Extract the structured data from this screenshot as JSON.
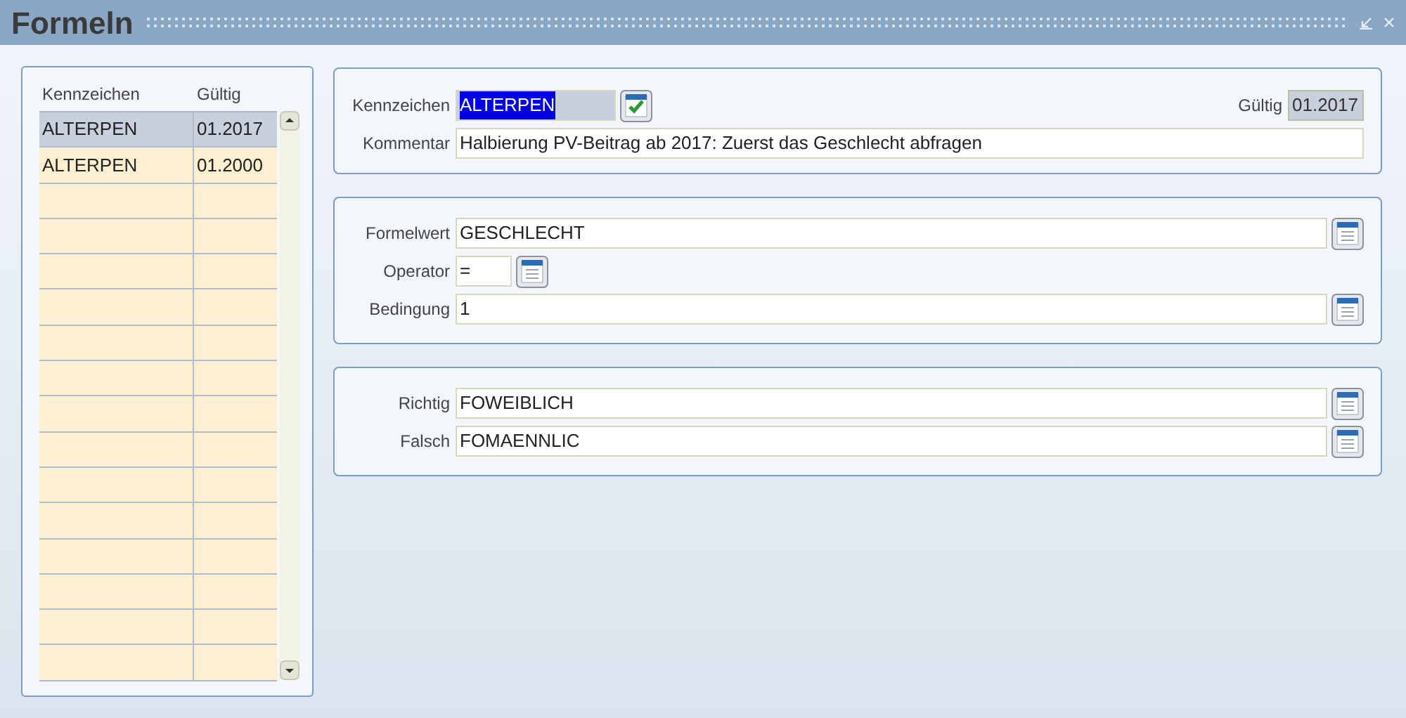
{
  "window": {
    "title": "Formeln"
  },
  "list": {
    "columns": [
      "Kennzeichen",
      "Gültig"
    ],
    "rows": [
      {
        "cells": [
          "ALTERPEN",
          "01.2017"
        ],
        "selected": true
      },
      {
        "cells": [
          "ALTERPEN",
          "01.2000"
        ],
        "selected": false
      }
    ]
  },
  "header": {
    "kennzeichen": {
      "label": "Kennzeichen",
      "value": "ALTERPEN",
      "highlighted": true
    },
    "gueltig": {
      "label": "Gültig",
      "value": "01.2017",
      "disabled": true
    },
    "kommentar": {
      "label": "Kommentar",
      "value": "Halbierung PV-Beitrag ab 2017: Zuerst das Geschlecht abfragen"
    }
  },
  "sections": [
    [
      {
        "label": "Formelwert",
        "value": "GESCHLECHT",
        "kind": "wide"
      },
      {
        "label": "Operator",
        "value": "=",
        "kind": "narrow"
      },
      {
        "label": "Bedingung",
        "value": "1",
        "kind": "wide"
      }
    ],
    [
      {
        "label": "Richtig",
        "value": "FOWEIBLICH",
        "kind": "wide"
      },
      {
        "label": "Falsch",
        "value": "FOMAENNLIC",
        "kind": "wide"
      }
    ]
  ]
}
